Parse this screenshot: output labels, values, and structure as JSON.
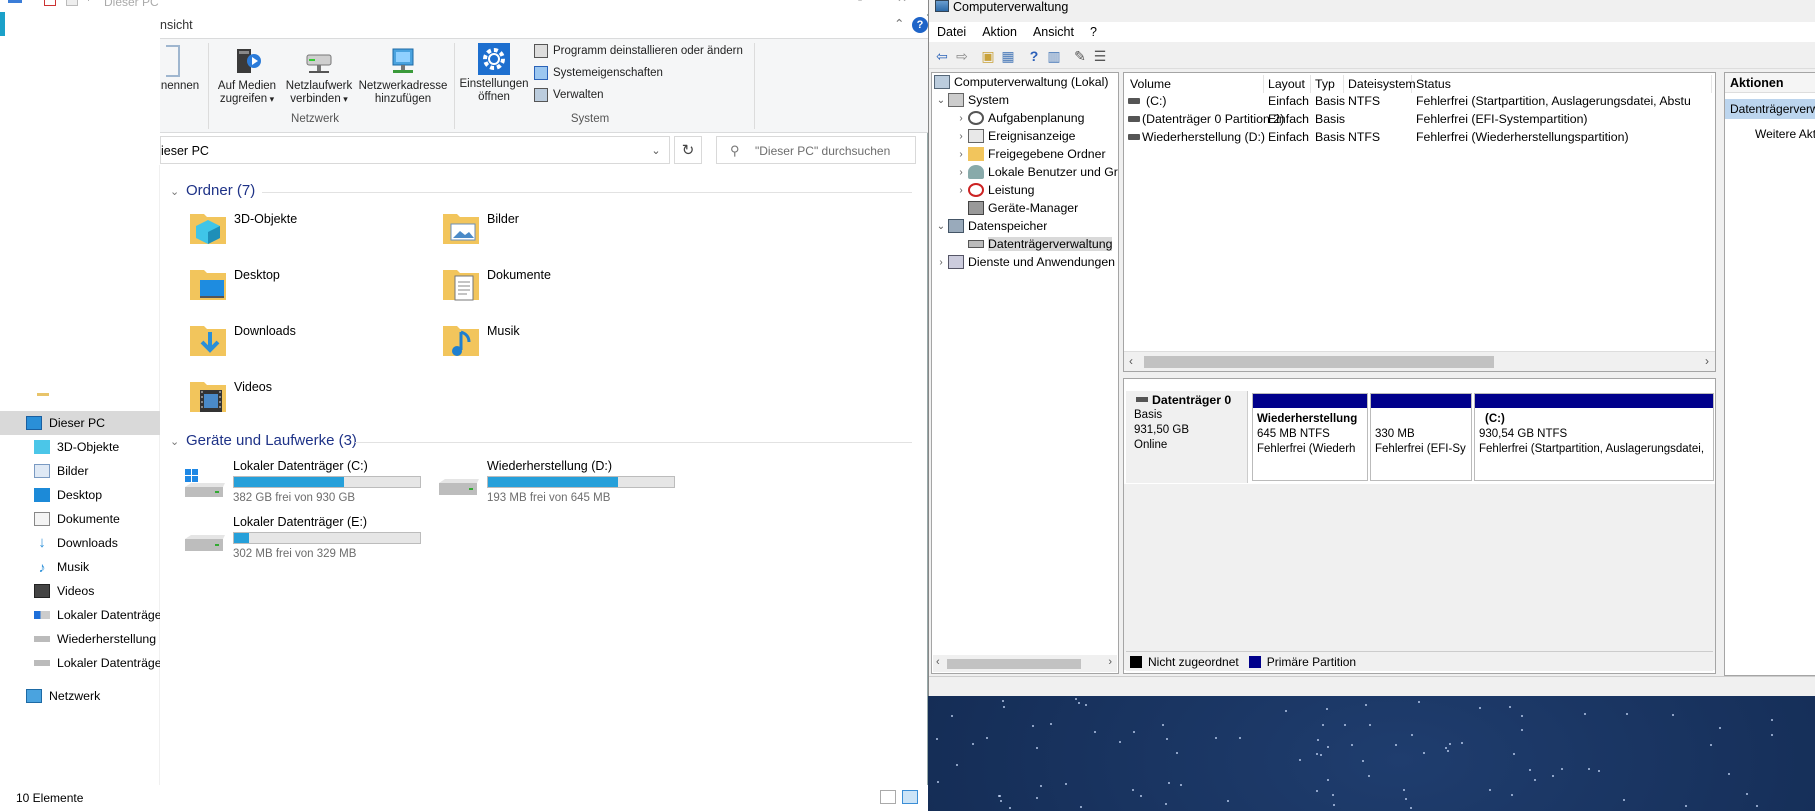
{
  "explorer": {
    "title": "Dieser PC",
    "ribbon_tab_view": "nsicht",
    "ribbon": {
      "rename_partial": "nennen",
      "network_group": "Netzwerk",
      "system_group": "System",
      "access_media": "Auf Medien zugreifen",
      "map_drive": "Netzlaufwerk verbinden",
      "add_network_location": "Netzwerkadresse hinzufügen",
      "open_settings": "Einstellungen öffnen",
      "uninstall_program": "Programm deinstallieren oder ändern",
      "system_properties": "Systemeigenschaften",
      "manage": "Verwalten"
    },
    "address": "ieser PC",
    "search_placeholder": "\"Dieser PC\" durchsuchen",
    "folders_header": "Ordner (7)",
    "folders": [
      "3D-Objekte",
      "Bilder",
      "Desktop",
      "Dokumente",
      "Downloads",
      "Musik",
      "Videos"
    ],
    "drives_header": "Geräte und Laufwerke (3)",
    "drives": [
      {
        "name": "Lokaler Datenträger (C:)",
        "free": "382 GB frei von 930 GB",
        "used_fraction": 0.59
      },
      {
        "name": "Wiederherstellung (D:)",
        "free": "193 MB frei von 645 MB",
        "used_fraction": 0.7
      },
      {
        "name": "Lokaler Datenträger (E:)",
        "free": "302 MB frei von 329 MB",
        "used_fraction": 0.08
      }
    ],
    "nav": [
      "Dieser PC",
      "3D-Objekte",
      "Bilder",
      "Desktop",
      "Dokumente",
      "Downloads",
      "Musik",
      "Videos",
      "Lokaler Datenträger",
      "Wiederherstellung (",
      "Lokaler Datenträger",
      "Netzwerk"
    ],
    "status_count": "10 Elemente"
  },
  "cm": {
    "title": "Computerverwaltung",
    "menu": [
      "Datei",
      "Aktion",
      "Ansicht",
      "?"
    ],
    "tree": [
      "Computerverwaltung (Lokal)",
      "System",
      "Aufgabenplanung",
      "Ereignisanzeige",
      "Freigegebene Ordner",
      "Lokale Benutzer und Gr",
      "Leistung",
      "Geräte-Manager",
      "Datenspeicher",
      "Datenträgerverwaltung",
      "Dienste und Anwendungen"
    ],
    "columns": [
      "Volume",
      "Layout",
      "Typ",
      "Dateisystem",
      "Status"
    ],
    "volumes": [
      {
        "volume": "(C:)",
        "layout": "Einfach",
        "typ": "Basis",
        "fs": "NTFS",
        "status": "Fehlerfrei (Startpartition, Auslagerungsdatei, Abstu"
      },
      {
        "volume": "(Datenträger 0 Partition 2)",
        "layout": "Einfach",
        "typ": "Basis",
        "fs": "",
        "status": "Fehlerfrei (EFI-Systempartition)"
      },
      {
        "volume": "Wiederherstellung (D:)",
        "layout": "Einfach",
        "typ": "Basis",
        "fs": "NTFS",
        "status": "Fehlerfrei (Wiederherstellungspartition)"
      }
    ],
    "disk": {
      "name": "Datenträger 0",
      "type": "Basis",
      "size": "931,50 GB",
      "state": "Online"
    },
    "partitions": [
      {
        "name": "Wiederherstellung",
        "size": "645 MB NTFS",
        "status": "Fehlerfrei (Wiederh"
      },
      {
        "name": "",
        "size": "330 MB",
        "status": "Fehlerfrei (EFI-Sy"
      },
      {
        "name": "(C:)",
        "size": "930,54 GB NTFS",
        "status": "Fehlerfrei (Startpartition, Auslagerungsdatei,"
      }
    ],
    "legend": {
      "unallocated": "Nicht zugeordnet",
      "primary": "Primäre Partition"
    },
    "actions_header": "Aktionen",
    "actions_selected": "Datenträgerverwa",
    "actions_more": "Weitere Akt"
  },
  "colors": {
    "accent": "#26a0da",
    "header_blue": "#1e3287",
    "partition_band": "#00008b"
  }
}
